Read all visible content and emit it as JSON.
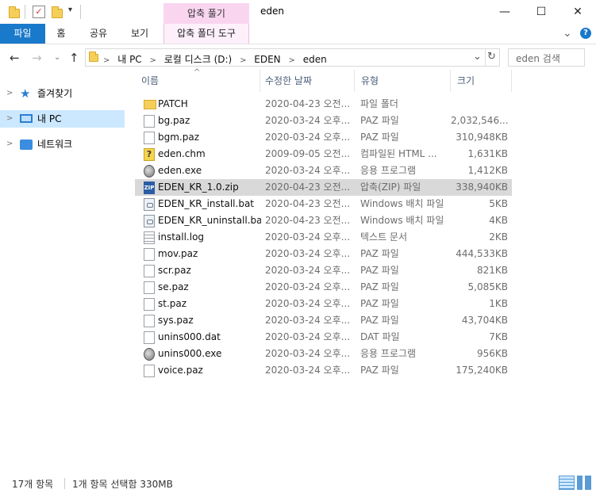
{
  "window": {
    "title": "eden",
    "context_tab_header": "압축 풀기",
    "minimize": "—",
    "maximize": "☐",
    "close": "✕"
  },
  "ribbon": {
    "tabs": [
      "파일",
      "홈",
      "공유",
      "보기"
    ],
    "context_tab": "압축 폴더 도구",
    "collapse": "⌄",
    "help": "?"
  },
  "address": {
    "crumbs": [
      "내 PC",
      "로컬 디스크 (D:)",
      "EDEN",
      "eden"
    ],
    "search_placeholder": "eden 검색",
    "refresh": "↻",
    "dropdown": "⌄"
  },
  "nav": {
    "items": [
      {
        "label": "즐겨찾기",
        "icon": "star-icon"
      },
      {
        "label": "내 PC",
        "icon": "computer-icon"
      },
      {
        "label": "네트워크",
        "icon": "network-icon"
      }
    ]
  },
  "columns": {
    "name": "이름",
    "date": "수정한 날짜",
    "type": "유형",
    "size": "크기"
  },
  "files": [
    {
      "name": "PATCH",
      "date": "2020-04-23 오전...",
      "type": "파일 폴더",
      "size": "",
      "icon": "folder-icon"
    },
    {
      "name": "bg.paz",
      "date": "2020-03-24 오후...",
      "type": "PAZ 파일",
      "size": "2,032,546...",
      "icon": "file-icon"
    },
    {
      "name": "bgm.paz",
      "date": "2020-03-24 오후...",
      "type": "PAZ 파일",
      "size": "310,948KB",
      "icon": "file-icon"
    },
    {
      "name": "eden.chm",
      "date": "2009-09-05 오전...",
      "type": "컴파일된 HTML ...",
      "size": "1,631KB",
      "icon": "help-file-icon"
    },
    {
      "name": "eden.exe",
      "date": "2020-03-24 오후...",
      "type": "응용 프로그램",
      "size": "1,412KB",
      "icon": "application-icon"
    },
    {
      "name": "EDEN_KR_1.0.zip",
      "date": "2020-04-23 오전...",
      "type": "압축(ZIP) 파일",
      "size": "338,940KB",
      "icon": "zip-icon",
      "selected": true
    },
    {
      "name": "EDEN_KR_install.bat",
      "date": "2020-04-23 오전...",
      "type": "Windows 배치 파일",
      "size": "5KB",
      "icon": "batch-icon"
    },
    {
      "name": "EDEN_KR_uninstall.bat",
      "date": "2020-04-23 오전...",
      "type": "Windows 배치 파일",
      "size": "4KB",
      "icon": "batch-icon"
    },
    {
      "name": "install.log",
      "date": "2020-03-24 오후...",
      "type": "텍스트 문서",
      "size": "2KB",
      "icon": "text-file-icon"
    },
    {
      "name": "mov.paz",
      "date": "2020-03-24 오후...",
      "type": "PAZ 파일",
      "size": "444,533KB",
      "icon": "file-icon"
    },
    {
      "name": "scr.paz",
      "date": "2020-03-24 오후...",
      "type": "PAZ 파일",
      "size": "821KB",
      "icon": "file-icon"
    },
    {
      "name": "se.paz",
      "date": "2020-03-24 오후...",
      "type": "PAZ 파일",
      "size": "5,085KB",
      "icon": "file-icon"
    },
    {
      "name": "st.paz",
      "date": "2020-03-24 오후...",
      "type": "PAZ 파일",
      "size": "1KB",
      "icon": "file-icon"
    },
    {
      "name": "sys.paz",
      "date": "2020-03-24 오후...",
      "type": "PAZ 파일",
      "size": "43,704KB",
      "icon": "file-icon"
    },
    {
      "name": "unins000.dat",
      "date": "2020-03-24 오후...",
      "type": "DAT 파일",
      "size": "7KB",
      "icon": "file-icon"
    },
    {
      "name": "unins000.exe",
      "date": "2020-03-24 오후...",
      "type": "응용 프로그램",
      "size": "956KB",
      "icon": "application-icon"
    },
    {
      "name": "voice.paz",
      "date": "2020-03-24 오후...",
      "type": "PAZ 파일",
      "size": "175,240KB",
      "icon": "file-icon"
    }
  ],
  "status": {
    "count": "17개 항목",
    "selection": "1개 항목 선택함 330MB"
  }
}
